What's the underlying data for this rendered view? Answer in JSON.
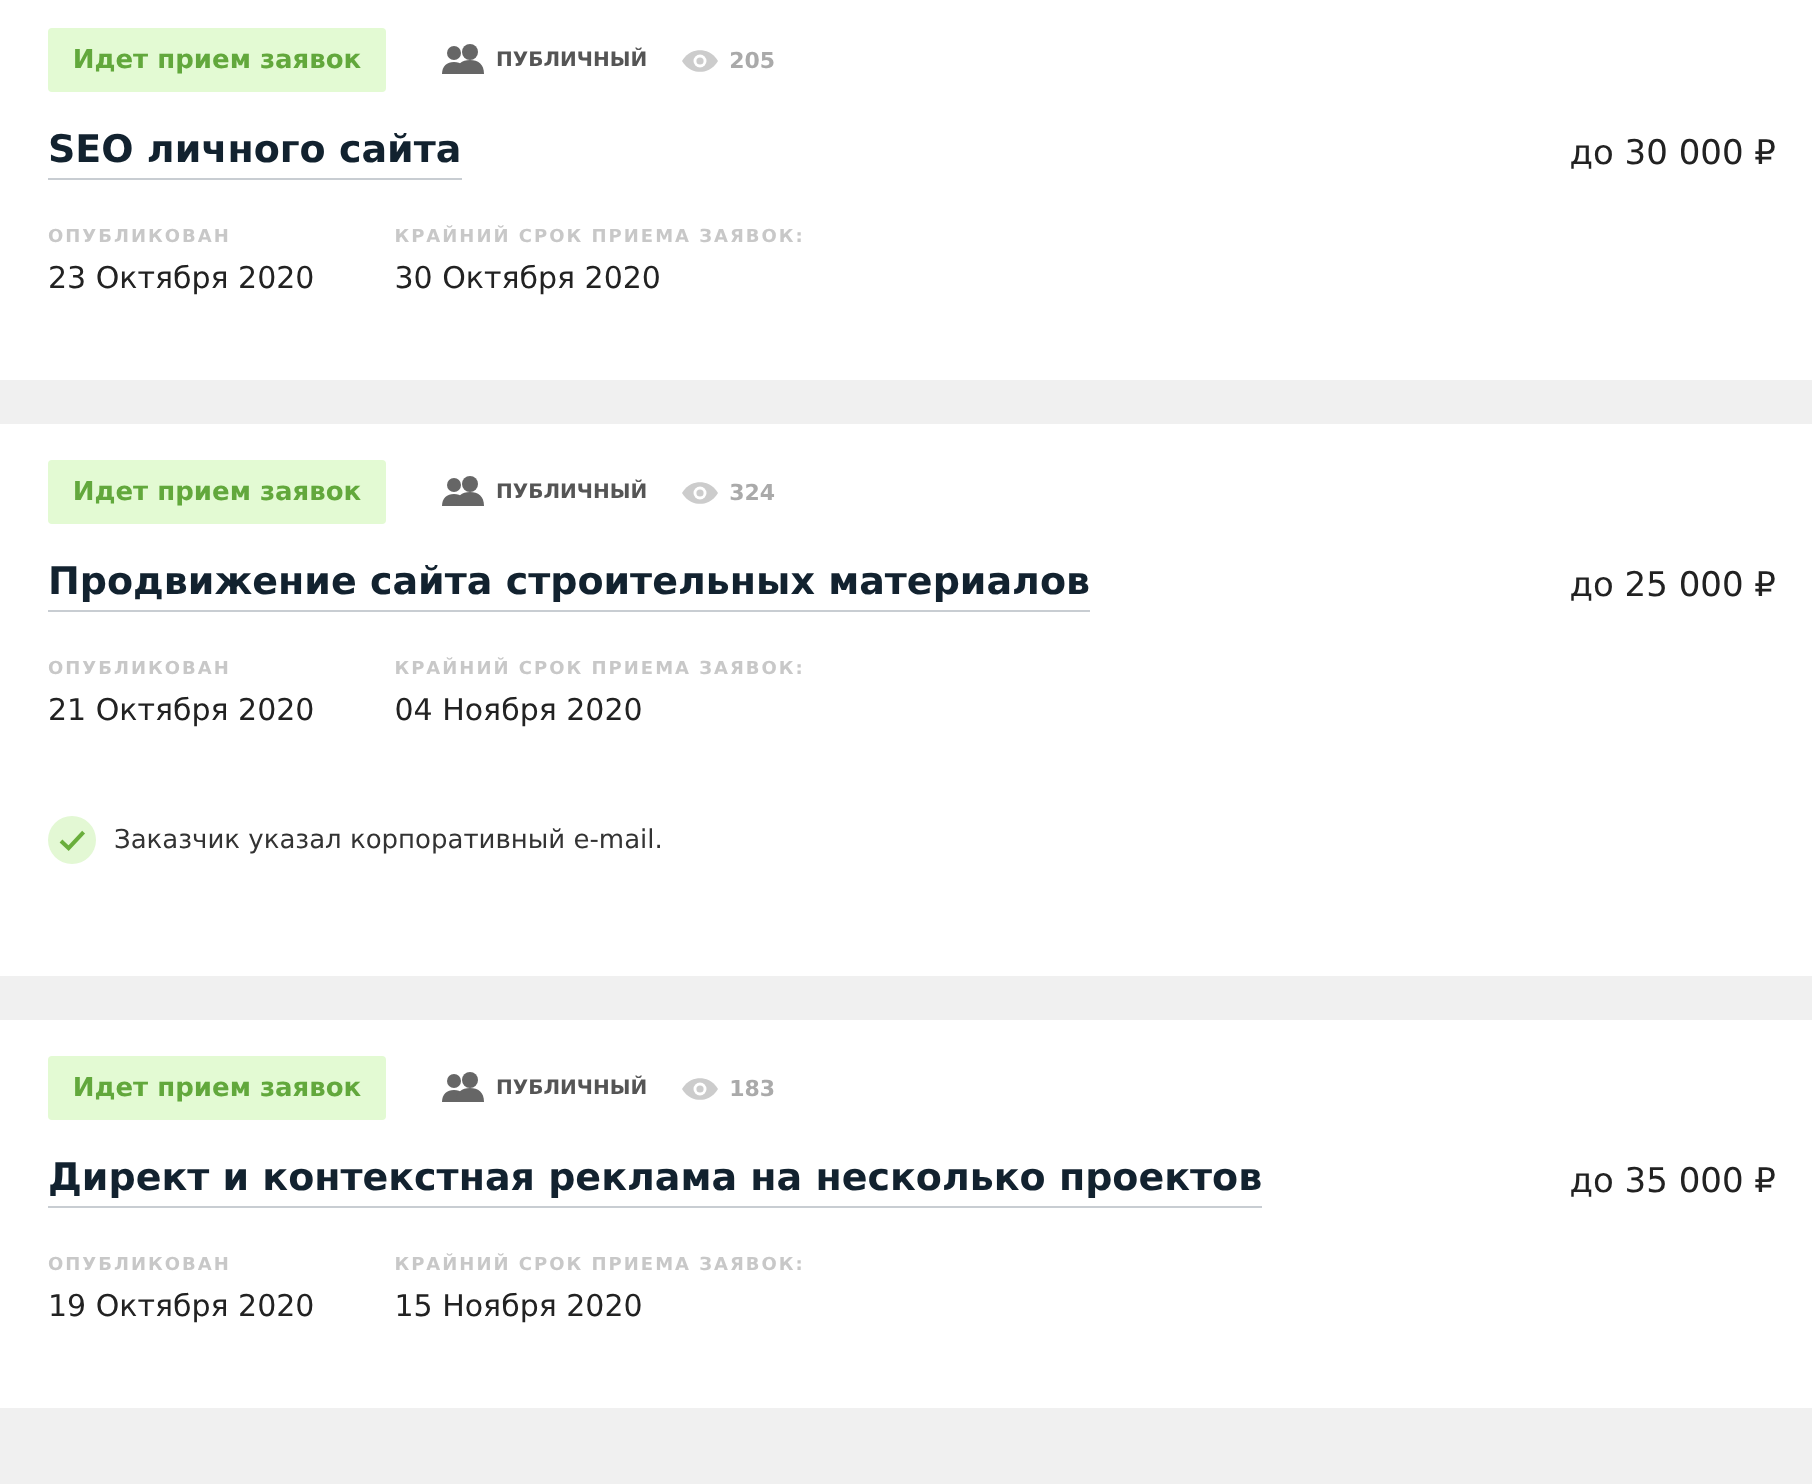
{
  "orders": [
    {
      "status": "Идет прием заявок",
      "access": "ПУБЛИЧНЫЙ",
      "views": "205",
      "title": "SEO личного сайта",
      "price": "до 30 000 ₽",
      "published_label": "ОПУБЛИКОВАН",
      "published": "23 Октября 2020",
      "deadline_label": "КРАЙНИЙ СРОК ПРИЕМА ЗАЯВОК:",
      "deadline": "30 Октября 2020"
    },
    {
      "status": "Идет прием заявок",
      "access": "ПУБЛИЧНЫЙ",
      "views": "324",
      "title": "Продвижение сайта строительных материалов",
      "price": "до 25 000 ₽",
      "published_label": "ОПУБЛИКОВАН",
      "published": "21 Октября 2020",
      "deadline_label": "КРАЙНИЙ СРОК ПРИЕМА ЗАЯВОК:",
      "deadline": "04 Ноября 2020",
      "note": "Заказчик указал корпоративный e-mail."
    },
    {
      "status": "Идет прием заявок",
      "access": "ПУБЛИЧНЫЙ",
      "views": "183",
      "title": "Директ и контекстная реклама на несколько проектов",
      "price": "до 35 000 ₽",
      "published_label": "ОПУБЛИКОВАН",
      "published": "19 Октября 2020",
      "deadline_label": "КРАЙНИЙ СРОК ПРИЕМА ЗАЯВОК:",
      "deadline": "15 Ноября 2020"
    }
  ]
}
